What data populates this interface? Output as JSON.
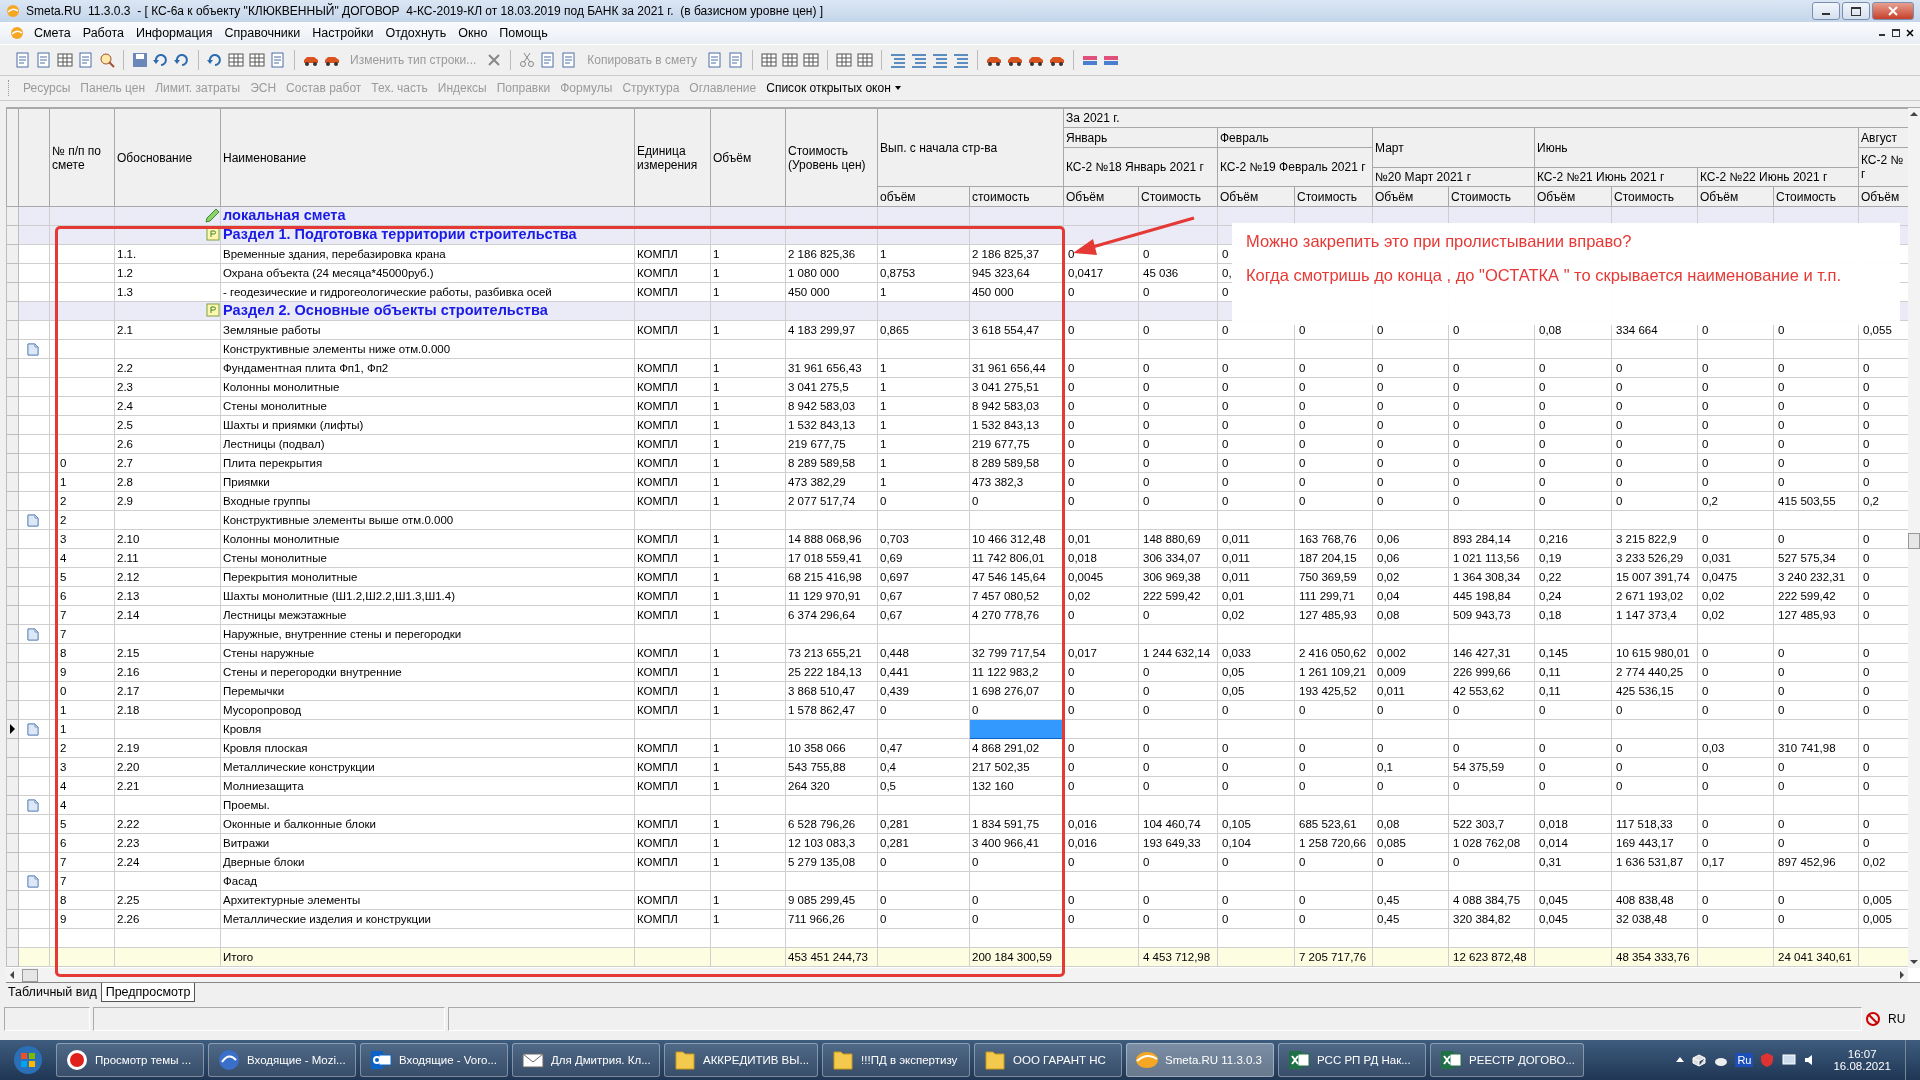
{
  "window": {
    "title": "Smeta.RU  11.3.0.3  - [ КС-6а к объекту \"КЛЮКВЕННЫЙ\" ДОГОВОР  4-КС-2019-КЛ от 18.03.2019 под БАНК за 2021 г.  (в базисном уровне цен) ]"
  },
  "menu": [
    "Смета",
    "Работа",
    "Информация",
    "Справочники",
    "Настройки",
    "Отдохнуть",
    "Окно",
    "Помощь"
  ],
  "toolbar": {
    "buttons": [
      {
        "label": "Изменить тип строки...",
        "disabled": true
      },
      {
        "label": "Копировать в смету",
        "disabled": true
      }
    ]
  },
  "panel_bar": [
    {
      "label": "Ресурсы",
      "disabled": true
    },
    {
      "label": "Панель цен",
      "disabled": true
    },
    {
      "label": "Лимит. затраты",
      "disabled": true
    },
    {
      "label": "ЭСН",
      "disabled": true
    },
    {
      "label": "Состав работ",
      "disabled": true
    },
    {
      "label": "Тех. часть",
      "disabled": true
    },
    {
      "label": "Индексы",
      "disabled": true
    },
    {
      "label": "Поправки",
      "disabled": true
    },
    {
      "label": "Формулы",
      "disabled": true
    },
    {
      "label": "Структура",
      "disabled": true
    },
    {
      "label": "Оглавление",
      "disabled": true
    },
    {
      "label": "Список открытых окон",
      "disabled": false,
      "kind": "dropdown"
    }
  ],
  "table": {
    "columns": [
      "№ п/п по смете",
      "Обоснование",
      "Наименование",
      "Единица измерения",
      "Объём",
      "Стоимость (Уровень цен)"
    ],
    "progress": {
      "label": "Вып. с начала стр-ва",
      "subcolumns": [
        "объём",
        "стоимость"
      ]
    },
    "period": "За 2021 г.",
    "months": [
      {
        "label": "Январь",
        "kind": "act-tall",
        "acts": [
          {
            "label": "КС-2 №18 Январь 2021 г",
            "subcolumns": [
              "Объём",
              "Стоимость"
            ]
          }
        ]
      },
      {
        "label": "Февраль",
        "kind": "act-tall",
        "acts": [
          {
            "label": "КС-2 №19 Февраль 2021 г",
            "subcolumns": [
              "Объём",
              "Стоимость"
            ]
          }
        ]
      },
      {
        "label": "Март",
        "kind": "month-tall",
        "acts": [
          {
            "label": "№20 Март 2021 г",
            "subcolumns": [
              "Объём",
              "Стоимость"
            ]
          }
        ]
      },
      {
        "label": "Июнь",
        "kind": "month-tall",
        "acts": [
          {
            "label": "КС-2 №21 Июнь 2021 г",
            "subcolumns": [
              "Объём",
              "Стоимость"
            ]
          },
          {
            "label": "КС-2 №22 Июнь 2021 г",
            "subcolumns": [
              "Объём",
              "Стоимость"
            ]
          }
        ]
      },
      {
        "label": "Август",
        "kind": "act-tall",
        "acts": [
          {
            "label": "КС-2 № г",
            "subcolumns": [
              "Объём"
            ]
          }
        ]
      }
    ],
    "rows": [
      {
        "kind": "title",
        "selected": false,
        "name": "локальная смета"
      },
      {
        "kind": "section",
        "selected": false,
        "name": "Раздел 1. Подготовка территории строительства"
      },
      {
        "kind": "item",
        "selected": false,
        "code": "1.1.",
        "name": "Временные здания, перебазировка крана",
        "unit": "КОМПЛ",
        "qty": "1",
        "cost": "2 186 825,36",
        "done_qty": "1",
        "done_cost": "2 186 825,37",
        "months": [
          "0",
          "0",
          "0"
        ]
      },
      {
        "kind": "item",
        "selected": false,
        "code": "1.2",
        "name": "Охрана объекта (24 месяца*45000руб.)",
        "unit": "КОМПЛ",
        "qty": "1",
        "cost": "1 080 000",
        "done_qty": "0,8753",
        "done_cost": "945 323,64",
        "months": [
          "0,0417",
          "45 036",
          "0,"
        ]
      },
      {
        "kind": "item",
        "selected": false,
        "code": "1.3",
        "name": "- геодезические и гидрогеологические работы, разбивка осей",
        "unit": "КОМПЛ",
        "qty": "1",
        "cost": "450 000",
        "done_qty": "1",
        "done_cost": "450 000",
        "months": [
          "0",
          "0",
          "0"
        ]
      },
      {
        "kind": "section",
        "selected": false,
        "name": "Раздел 2. Основные объекты строительства"
      },
      {
        "kind": "item",
        "selected": false,
        "code": "2.1",
        "name": "Земляные работы",
        "unit": "КОМПЛ",
        "qty": "1",
        "cost": "4 183 299,97",
        "done_qty": "0,865",
        "done_cost": "3 618 554,47",
        "months": [
          "0",
          "0",
          "0",
          "0",
          "0",
          "0",
          "0,08",
          "334 664",
          "0",
          "0",
          "0,055"
        ]
      },
      {
        "kind": "group",
        "selected": false,
        "name": "Конструктивные элементы ниже отм.0.000"
      },
      {
        "kind": "item",
        "selected": false,
        "code": "2.2",
        "name": "Фундаментная плита Фп1, Фп2",
        "unit": "КОМПЛ",
        "qty": "1",
        "cost": "31 961 656,43",
        "done_qty": "1",
        "done_cost": "31 961 656,44",
        "months": [
          "0",
          "0",
          "0",
          "0",
          "0",
          "0",
          "0",
          "0",
          "0",
          "0",
          "0"
        ]
      },
      {
        "kind": "item",
        "selected": false,
        "code": "2.3",
        "name": "Колонны монолитные",
        "unit": "КОМПЛ",
        "qty": "1",
        "cost": "3 041 275,5",
        "done_qty": "1",
        "done_cost": "3 041 275,51",
        "months": [
          "0",
          "0",
          "0",
          "0",
          "0",
          "0",
          "0",
          "0",
          "0",
          "0",
          "0"
        ]
      },
      {
        "kind": "item",
        "selected": false,
        "code": "2.4",
        "name": "Стены монолитные",
        "unit": "КОМПЛ",
        "qty": "1",
        "cost": "8 942 583,03",
        "done_qty": "1",
        "done_cost": "8 942 583,03",
        "months": [
          "0",
          "0",
          "0",
          "0",
          "0",
          "0",
          "0",
          "0",
          "0",
          "0",
          "0"
        ]
      },
      {
        "kind": "item",
        "selected": false,
        "code": "2.5",
        "name": "Шахты и приямки (лифты)",
        "unit": "КОМПЛ",
        "qty": "1",
        "cost": "1 532 843,13",
        "done_qty": "1",
        "done_cost": "1 532 843,13",
        "months": [
          "0",
          "0",
          "0",
          "0",
          "0",
          "0",
          "0",
          "0",
          "0",
          "0",
          "0"
        ]
      },
      {
        "kind": "item",
        "selected": false,
        "code": "2.6",
        "name": "Лестницы (подвал)",
        "unit": "КОМПЛ",
        "qty": "1",
        "cost": "219 677,75",
        "done_qty": "1",
        "done_cost": "219 677,75",
        "months": [
          "0",
          "0",
          "0",
          "0",
          "0",
          "0",
          "0",
          "0",
          "0",
          "0",
          "0"
        ]
      },
      {
        "kind": "item",
        "selected": false,
        "n": "0",
        "code": "2.7",
        "name": "Плита перекрытия",
        "unit": "КОМПЛ",
        "qty": "1",
        "cost": "8 289 589,58",
        "done_qty": "1",
        "done_cost": "8 289 589,58",
        "months": [
          "0",
          "0",
          "0",
          "0",
          "0",
          "0",
          "0",
          "0",
          "0",
          "0",
          "0"
        ]
      },
      {
        "kind": "item",
        "selected": false,
        "n": "1",
        "code": "2.8",
        "name": "Приямки",
        "unit": "КОМПЛ",
        "qty": "1",
        "cost": "473 382,29",
        "done_qty": "1",
        "done_cost": "473 382,3",
        "months": [
          "0",
          "0",
          "0",
          "0",
          "0",
          "0",
          "0",
          "0",
          "0",
          "0",
          "0"
        ]
      },
      {
        "kind": "item",
        "selected": false,
        "n": "2",
        "code": "2.9",
        "name": "Входные группы",
        "unit": "КОМПЛ",
        "qty": "1",
        "cost": "2 077 517,74",
        "done_qty": "0",
        "done_cost": "0",
        "months": [
          "0",
          "0",
          "0",
          "0",
          "0",
          "0",
          "0",
          "0",
          "0,2",
          "415 503,55",
          "0,2"
        ]
      },
      {
        "kind": "group",
        "selected": false,
        "n": "2",
        "name": "Конструктивные элементы выше отм.0.000"
      },
      {
        "kind": "item",
        "selected": false,
        "n": "3",
        "code": "2.10",
        "name": "Колонны монолитные",
        "unit": "КОМПЛ",
        "qty": "1",
        "cost": "14 888 068,96",
        "done_qty": "0,703",
        "done_cost": "10 466 312,48",
        "months": [
          "0,01",
          "148 880,69",
          "0,011",
          "163 768,76",
          "0,06",
          "893 284,14",
          "0,216",
          "3 215 822,9",
          "0",
          "0",
          "0"
        ]
      },
      {
        "kind": "item",
        "selected": false,
        "n": "4",
        "code": "2.11",
        "name": "Стены монолитные",
        "unit": "КОМПЛ",
        "qty": "1",
        "cost": "17 018 559,41",
        "done_qty": "0,69",
        "done_cost": "11 742 806,01",
        "months": [
          "0,018",
          "306 334,07",
          "0,011",
          "187 204,15",
          "0,06",
          "1 021 113,56",
          "0,19",
          "3 233 526,29",
          "0,031",
          "527 575,34",
          "0"
        ]
      },
      {
        "kind": "item",
        "selected": false,
        "n": "5",
        "code": "2.12",
        "name": "Перекрытия монолитные",
        "unit": "КОМПЛ",
        "qty": "1",
        "cost": "68 215 416,98",
        "done_qty": "0,697",
        "done_cost": "47 546 145,64",
        "months": [
          "0,0045",
          "306 969,38",
          "0,011",
          "750 369,59",
          "0,02",
          "1 364 308,34",
          "0,22",
          "15 007 391,74",
          "0,0475",
          "3 240 232,31",
          "0"
        ]
      },
      {
        "kind": "item",
        "selected": false,
        "n": "6",
        "code": "2.13",
        "name": "Шахты монолитные (Ш1.2,Ш2.2,Ш1.3,Ш1.4)",
        "unit": "КОМПЛ",
        "qty": "1",
        "cost": "11 129 970,91",
        "done_qty": "0,67",
        "done_cost": "7 457 080,52",
        "months": [
          "0,02",
          "222 599,42",
          "0,01",
          "111 299,71",
          "0,04",
          "445 198,84",
          "0,24",
          "2 671 193,02",
          "0,02",
          "222 599,42",
          "0"
        ]
      },
      {
        "kind": "item",
        "selected": false,
        "n": "7",
        "code": "2.14",
        "name": "Лестницы межэтажные",
        "unit": "КОМПЛ",
        "qty": "1",
        "cost": "6 374 296,64",
        "done_qty": "0,67",
        "done_cost": "4 270 778,76",
        "months": [
          "0",
          "0",
          "0,02",
          "127 485,93",
          "0,08",
          "509 943,73",
          "0,18",
          "1 147 373,4",
          "0,02",
          "127 485,93",
          "0"
        ]
      },
      {
        "kind": "group",
        "selected": false,
        "n": "7",
        "name": "Наружные, внутренние стены и перегородки"
      },
      {
        "kind": "item",
        "selected": false,
        "n": "8",
        "code": "2.15",
        "name": "Стены наружные",
        "unit": "КОМПЛ",
        "qty": "1",
        "cost": "73 213 655,21",
        "done_qty": "0,448",
        "done_cost": "32 799 717,54",
        "months": [
          "0,017",
          "1 244 632,14",
          "0,033",
          "2 416 050,62",
          "0,002",
          "146 427,31",
          "0,145",
          "10 615 980,01",
          "0",
          "0",
          "0"
        ]
      },
      {
        "kind": "item",
        "selected": false,
        "n": "9",
        "code": "2.16",
        "name": "Стены и перегородки внутренние",
        "unit": "КОМПЛ",
        "qty": "1",
        "cost": "25 222 184,13",
        "done_qty": "0,441",
        "done_cost": "11 122 983,2",
        "months": [
          "0",
          "0",
          "0,05",
          "1 261 109,21",
          "0,009",
          "226 999,66",
          "0,11",
          "2 774 440,25",
          "0",
          "0",
          "0"
        ]
      },
      {
        "kind": "item",
        "selected": false,
        "n": "0",
        "code": "2.17",
        "name": "Перемычки",
        "unit": "КОМПЛ",
        "qty": "1",
        "cost": "3 868 510,47",
        "done_qty": "0,439",
        "done_cost": "1 698 276,07",
        "months": [
          "0",
          "0",
          "0,05",
          "193 425,52",
          "0,011",
          "42 553,62",
          "0,11",
          "425 536,15",
          "0",
          "0",
          "0"
        ]
      },
      {
        "kind": "item",
        "selected": false,
        "n": "1",
        "code": "2.18",
        "name": "Мусоропровод",
        "unit": "КОМПЛ",
        "qty": "1",
        "cost": "1 578 862,47",
        "done_qty": "0",
        "done_cost": "0",
        "months": [
          "0",
          "0",
          "0",
          "0",
          "0",
          "0",
          "0",
          "0",
          "0",
          "0",
          "0"
        ]
      },
      {
        "kind": "group",
        "selected": true,
        "n": "1",
        "name": "Кровля"
      },
      {
        "kind": "item",
        "selected": false,
        "n": "2",
        "code": "2.19",
        "name": "Кровля плоская",
        "unit": "КОМПЛ",
        "qty": "1",
        "cost": "10 358 066",
        "done_qty": "0,47",
        "done_cost": "4 868 291,02",
        "months": [
          "0",
          "0",
          "0",
          "0",
          "0",
          "0",
          "0",
          "0",
          "0,03",
          "310 741,98",
          "0"
        ]
      },
      {
        "kind": "item",
        "selected": false,
        "n": "3",
        "code": "2.20",
        "name": "Металлические конструкции",
        "unit": "КОМПЛ",
        "qty": "1",
        "cost": "543 755,88",
        "done_qty": "0,4",
        "done_cost": "217 502,35",
        "months": [
          "0",
          "0",
          "0",
          "0",
          "0,1",
          "54 375,59",
          "0",
          "0",
          "0",
          "0",
          "0"
        ]
      },
      {
        "kind": "item",
        "selected": false,
        "n": "4",
        "code": "2.21",
        "name": "Молниезащита",
        "unit": "КОМПЛ",
        "qty": "1",
        "cost": "264 320",
        "done_qty": "0,5",
        "done_cost": "132 160",
        "months": [
          "0",
          "0",
          "0",
          "0",
          "0",
          "0",
          "0",
          "0",
          "0",
          "0",
          "0"
        ]
      },
      {
        "kind": "group",
        "selected": false,
        "n": "4",
        "name": "Проемы."
      },
      {
        "kind": "item",
        "selected": false,
        "n": "5",
        "code": "2.22",
        "name": "Оконные и балконные блоки",
        "unit": "КОМПЛ",
        "qty": "1",
        "cost": "6 528 796,26",
        "done_qty": "0,281",
        "done_cost": "1 834 591,75",
        "months": [
          "0,016",
          "104 460,74",
          "0,105",
          "685 523,61",
          "0,08",
          "522 303,7",
          "0,018",
          "117 518,33",
          "0",
          "0",
          "0"
        ]
      },
      {
        "kind": "item",
        "selected": false,
        "n": "6",
        "code": "2.23",
        "name": "Витражи",
        "unit": "КОМПЛ",
        "qty": "1",
        "cost": "12 103 083,3",
        "done_qty": "0,281",
        "done_cost": "3 400 966,41",
        "months": [
          "0,016",
          "193 649,33",
          "0,104",
          "1 258 720,66",
          "0,085",
          "1 028 762,08",
          "0,014",
          "169 443,17",
          "0",
          "0",
          "0"
        ]
      },
      {
        "kind": "item",
        "selected": false,
        "n": "7",
        "code": "2.24",
        "name": "Дверные блоки",
        "unit": "КОМПЛ",
        "qty": "1",
        "cost": "5 279 135,08",
        "done_qty": "0",
        "done_cost": "0",
        "months": [
          "0",
          "0",
          "0",
          "0",
          "0",
          "0",
          "0,31",
          "1 636 531,87",
          "0,17",
          "897 452,96",
          "0,02"
        ]
      },
      {
        "kind": "group",
        "selected": false,
        "n": "7",
        "name": "Фасад"
      },
      {
        "kind": "item",
        "selected": false,
        "n": "8",
        "code": "2.25",
        "name": "Архитектурные элементы",
        "unit": "КОМПЛ",
        "qty": "1",
        "cost": "9 085 299,45",
        "done_qty": "0",
        "done_cost": "0",
        "months": [
          "0",
          "0",
          "0",
          "0",
          "0,45",
          "4 088 384,75",
          "0,045",
          "408 838,48",
          "0",
          "0",
          "0,005"
        ]
      },
      {
        "kind": "item",
        "selected": false,
        "n": "9",
        "code": "2.26",
        "name": "Металлические изделия и конструкции",
        "unit": "КОМПЛ",
        "qty": "1",
        "cost": "711 966,26",
        "done_qty": "0",
        "done_cost": "0",
        "months": [
          "0",
          "0",
          "0",
          "0",
          "0,45",
          "320 384,82",
          "0,045",
          "32 038,48",
          "0",
          "0",
          "0,005"
        ]
      },
      {
        "kind": "empty",
        "selected": false
      },
      {
        "kind": "total",
        "selected": false,
        "name": "Итого",
        "cost": "453 451 244,73",
        "done_cost": "200 184 300,59",
        "cost_totals": [
          "4 453 712,98",
          "7 205 717,76",
          "12 623 872,48",
          "48 354 333,76",
          "24 041 340,61"
        ]
      }
    ]
  },
  "annotation": {
    "lines": [
      "Можно закрепить это при пролистывании вправо?",
      "Когда смотришь до конца , до \"ОСТАТКА \" то скрывается наименование и т.п."
    ]
  },
  "view_tabs": [
    {
      "label": "Табличный вид",
      "selected": true
    },
    {
      "label": "Предпросмотр",
      "selected": false
    }
  ],
  "status_bar": {
    "language": "RU"
  },
  "taskbar": {
    "tasks": [
      {
        "label": "Просмотр темы ...",
        "kind": "browser",
        "selected": false
      },
      {
        "label": "Входящие - Mozi...",
        "kind": "mail",
        "selected": false
      },
      {
        "label": "Входящие - Voro...",
        "kind": "outlook",
        "selected": false
      },
      {
        "label": "Для Дмитрия. Кл...",
        "kind": "letter",
        "selected": false
      },
      {
        "label": "АККРЕДИТИВ ВЫ...",
        "kind": "folder",
        "selected": false
      },
      {
        "label": "!!!ПД в экспертизу",
        "kind": "folder",
        "selected": false
      },
      {
        "label": "ООО ГАРАНТ НС",
        "kind": "folder",
        "selected": false
      },
      {
        "label": "Smeta.RU  11.3.0.3",
        "kind": "app",
        "selected": true
      },
      {
        "label": "РСС  РП  РД  Нак...",
        "kind": "excel",
        "selected": false
      },
      {
        "label": "РЕЕСТР ДОГОВО...",
        "kind": "excel",
        "selected": false
      }
    ],
    "tray_language": "Ru",
    "time": "16:07",
    "date": "16.08.2021"
  }
}
